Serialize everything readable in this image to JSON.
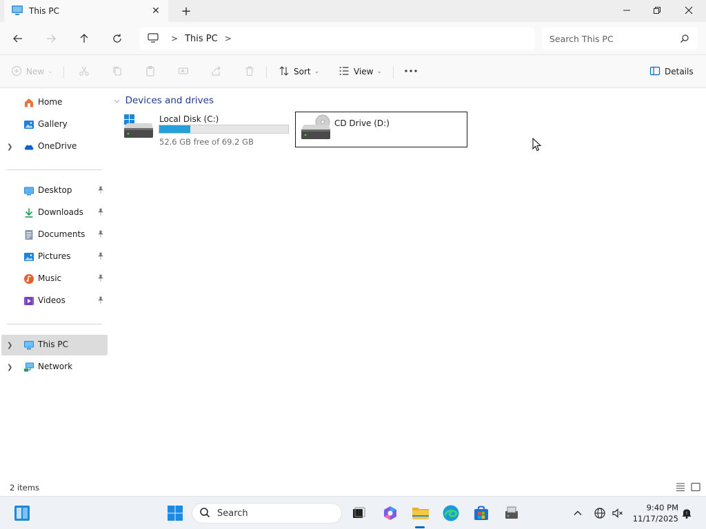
{
  "window": {
    "tab_title": "This PC",
    "tab_close_icon": "close-icon",
    "new_tab_icon": "plus-icon"
  },
  "address_bar": {
    "breadcrumbs": [
      "This PC"
    ],
    "search_placeholder": "Search This PC"
  },
  "command_bar": {
    "new_label": "New",
    "sort_label": "Sort",
    "view_label": "View",
    "details_label": "Details"
  },
  "sidebar": {
    "top_items": [
      {
        "label": "Home",
        "icon": "home-icon"
      },
      {
        "label": "Gallery",
        "icon": "gallery-icon"
      },
      {
        "label": "OneDrive",
        "icon": "cloud-icon"
      }
    ],
    "quick_access": [
      {
        "label": "Desktop",
        "icon": "desktop-folder-icon"
      },
      {
        "label": "Downloads",
        "icon": "download-icon"
      },
      {
        "label": "Documents",
        "icon": "documents-icon"
      },
      {
        "label": "Pictures",
        "icon": "pictures-icon"
      },
      {
        "label": "Music",
        "icon": "music-icon"
      },
      {
        "label": "Videos",
        "icon": "videos-icon"
      }
    ],
    "bottom_items": [
      {
        "label": "This PC",
        "icon": "computer-icon",
        "selected": true
      },
      {
        "label": "Network",
        "icon": "network-icon"
      }
    ]
  },
  "content": {
    "group_title": "Devices and drives",
    "drives": [
      {
        "name": "Local Disk (C:)",
        "free_text": "52.6 GB free of 69.2 GB",
        "used_fraction": 0.24
      },
      {
        "name": "CD Drive (D:)"
      }
    ]
  },
  "status_bar": {
    "item_count": "2 items"
  },
  "taskbar": {
    "search_label": "Search",
    "time": "9:40 PM",
    "date": "11/17/2025"
  },
  "colors": {
    "accent": "#0067c0",
    "drive_bar_fill": "#26a0da",
    "group_header": "#1e3c8c",
    "selected_nav": "#dcdcdc"
  }
}
